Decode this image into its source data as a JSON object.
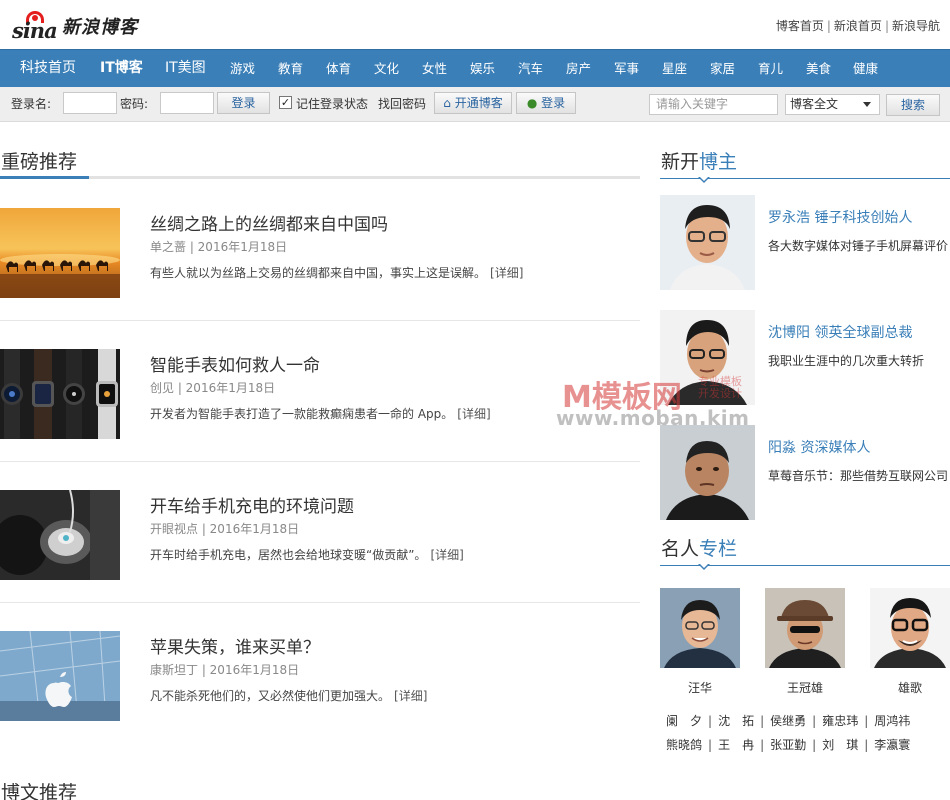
{
  "header": {
    "logo_text": "sina",
    "logo_cn": "新浪博客",
    "links": [
      "博客首页",
      "新浪首页",
      "新浪导航"
    ],
    "link_separator": "|"
  },
  "nav": {
    "items": [
      "科技首页",
      "IT博客",
      "IT美图",
      "游戏",
      "教育",
      "体育",
      "文化",
      "女性",
      "娱乐",
      "汽车",
      "房产",
      "军事",
      "星座",
      "家居",
      "育儿",
      "美食",
      "健康"
    ],
    "active_index": 1,
    "bg_color": "#3a7fb8"
  },
  "login": {
    "username_label": "登录名:",
    "password_label": "密码:",
    "login_button": "登录",
    "remember_label": "记住登录状态",
    "remember_checked": true,
    "forgot_label": "找回密码",
    "open_blog_button": "开通博客",
    "login_button2": "登录",
    "search_placeholder": "请输入关键字",
    "search_scope": "博客全文",
    "search_button": "搜索"
  },
  "featured": {
    "title": "重磅推荐",
    "articles": [
      {
        "title": "丝绸之路上的丝绸都来自中国吗",
        "meta": "单之蔷 | 2016年1月18日",
        "summary": "有些人就以为丝路上交易的丝绸都来自中国，事实上这是误解。",
        "detail": "[详细]",
        "thumb_icon": "desert-camel-caravan-image"
      },
      {
        "title": "智能手表如何救人一命",
        "meta": "创见 | 2016年1月18日",
        "summary": "开发者为智能手表打造了一款能救癫痫患者一命的 App。",
        "detail": "[详细]",
        "thumb_icon": "smartwatches-image"
      },
      {
        "title": "开车给手机充电的环境问题",
        "meta": "开眼视点 | 2016年1月18日",
        "summary": "开车时给手机充电，居然也会给地球变暖“做贡献”。",
        "detail": "[详细]",
        "thumb_icon": "car-charger-image"
      },
      {
        "title": "苹果失策，谁来买单？",
        "meta": "康斯坦丁 | 2016年1月18日",
        "summary": "凡不能杀死他们的，又必然使他们更加强大。",
        "detail": "[详细]",
        "thumb_icon": "apple-store-image"
      }
    ]
  },
  "new_bloggers": {
    "title_plain": "新开",
    "title_highlight": "博主",
    "items": [
      {
        "name": "罗永浩 锤子科技创始人",
        "desc": "各大数字媒体对锤子手机屏幕评价"
      },
      {
        "name": "沈博阳 领英全球副总裁",
        "desc": "我职业生涯中的几次重大转折"
      },
      {
        "name": "阳淼 资深媒体人",
        "desc": "草莓音乐节：那些借势互联网公司"
      }
    ]
  },
  "columns": {
    "title_plain": "名人",
    "title_highlight": "专栏",
    "featured": [
      "汪华",
      "王冠雄",
      "雄歌"
    ],
    "row1": [
      "阑　夕",
      "沈　拓",
      "侯继勇",
      "雍忠玮",
      "周鸿祎"
    ],
    "row2": [
      "熊晓鸽",
      "王　冉",
      "张亚勤",
      "刘　琪",
      "李瀛寰"
    ],
    "separator": "|"
  },
  "blog_recommend": {
    "title": "博文推荐"
  },
  "watermark": {
    "brand": "M模板网",
    "tag_line1": "专业模板",
    "tag_line2": "开发设计",
    "url": "www.moban.kim"
  }
}
